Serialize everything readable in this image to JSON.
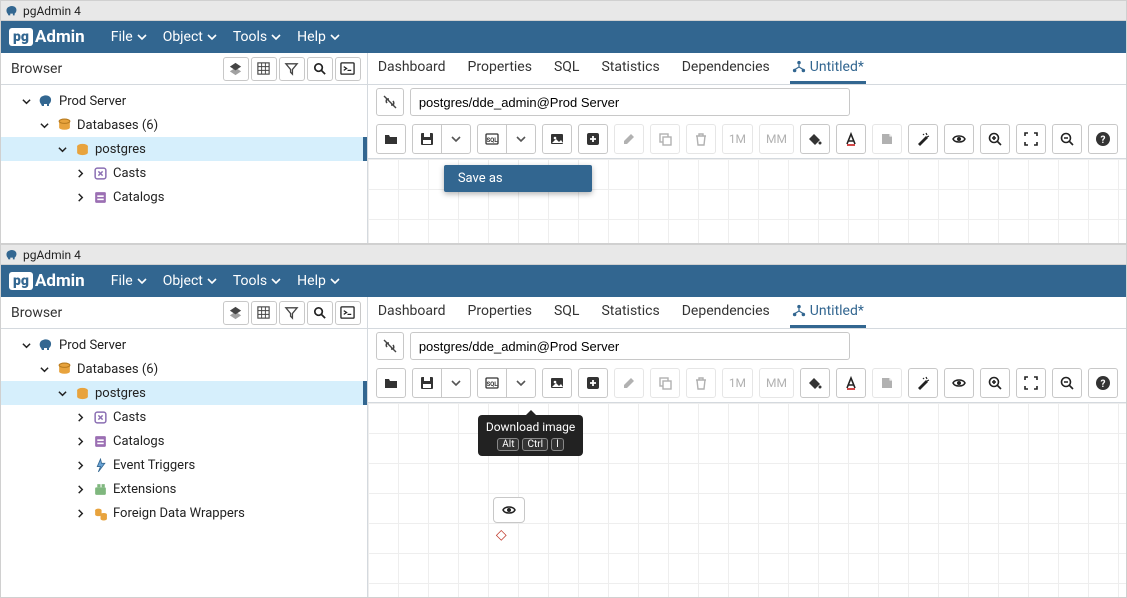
{
  "app": {
    "title": "pgAdmin 4",
    "logo_text": "Admin",
    "logo_badge": "pg"
  },
  "menu": {
    "file": "File",
    "object": "Object",
    "tools": "Tools",
    "help": "Help"
  },
  "sidebar": {
    "title": "Browser"
  },
  "tree": {
    "server": "Prod Server",
    "databases": "Databases (6)",
    "postgres": "postgres",
    "casts": "Casts",
    "catalogs": "Catalogs",
    "event_triggers": "Event Triggers",
    "extensions": "Extensions",
    "fdw": "Foreign Data Wrappers"
  },
  "tabs": {
    "dashboard": "Dashboard",
    "properties": "Properties",
    "sql": "SQL",
    "statistics": "Statistics",
    "dependencies": "Dependencies",
    "untitled": "Untitled*"
  },
  "connection": {
    "value": "postgres/dde_admin@Prod Server"
  },
  "toolbar": {
    "limit1": "1M",
    "limit2": "MM"
  },
  "popover": {
    "save_as": "Save as"
  },
  "tooltip": {
    "download_image": "Download image",
    "alt": "Alt",
    "ctrl": "Ctrl",
    "i": "I"
  },
  "colors": {
    "brand": "#326690"
  }
}
